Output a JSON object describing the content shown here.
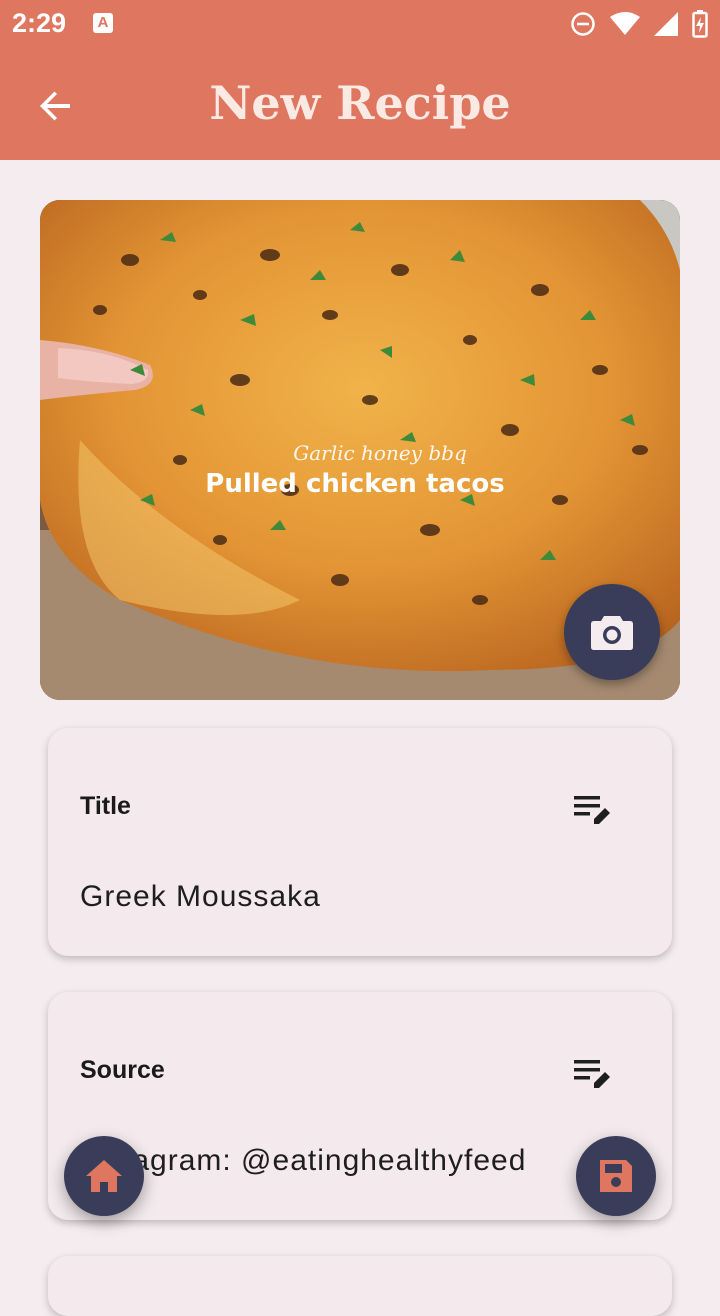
{
  "status_bar": {
    "time": "2:29",
    "notification_icon": "a-icon",
    "notification_letter": "A",
    "icons": [
      "do-not-disturb-icon",
      "wifi-icon",
      "signal-icon",
      "battery-icon"
    ]
  },
  "app_bar": {
    "title": "New Recipe",
    "back_icon": "arrow-left-icon"
  },
  "recipe_image": {
    "overlay_caption": "Garlic honey bbq",
    "overlay_title": "Pulled chicken tacos",
    "camera_icon": "camera-icon"
  },
  "fields": [
    {
      "label": "Title",
      "value": "Greek Moussaka",
      "icon": "edit-note-icon"
    },
    {
      "label": "Source",
      "value": "Instagram: @eatinghealthyfeed",
      "icon": "edit-note-icon"
    }
  ],
  "fabs": {
    "home_icon": "home-icon",
    "save_icon": "save-icon"
  },
  "colors": {
    "primary": "#de7660",
    "fab": "#3a3d59",
    "background": "#f4ecef",
    "title_text": "#fbe9e4"
  }
}
